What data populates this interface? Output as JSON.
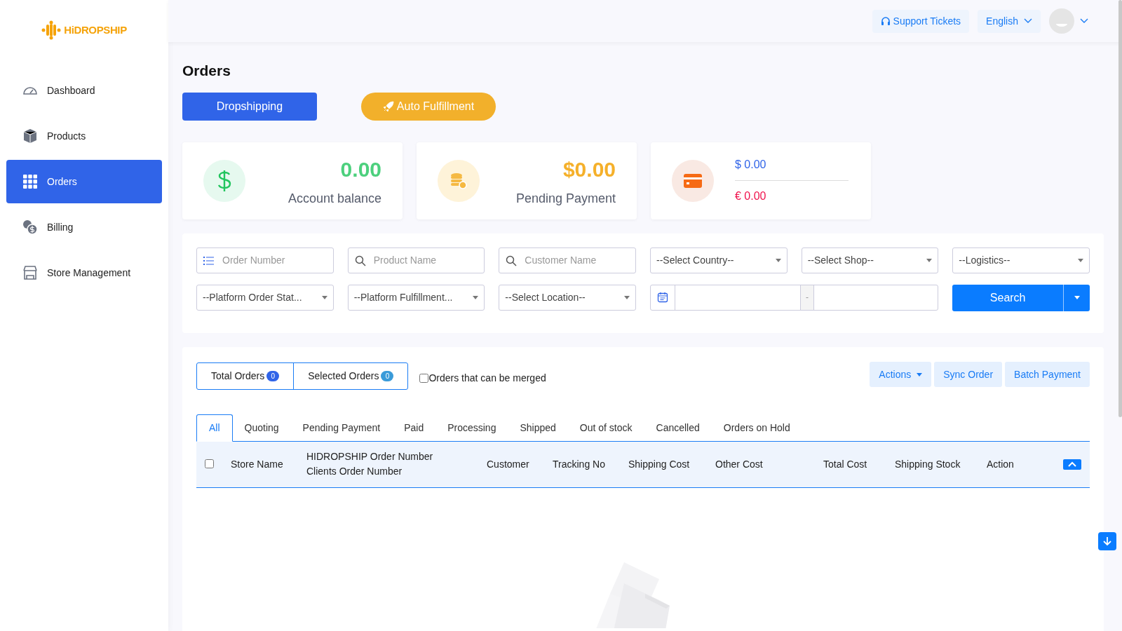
{
  "logo": {
    "text": "HiDROPSHIP"
  },
  "header": {
    "support": "Support Tickets",
    "language": "English"
  },
  "sidebar": {
    "items": [
      {
        "label": "Dashboard",
        "selected": false
      },
      {
        "label": "Products",
        "selected": false
      },
      {
        "label": "Orders",
        "selected": true
      },
      {
        "label": "Billing",
        "selected": false
      },
      {
        "label": "Store Management",
        "selected": false
      }
    ]
  },
  "page_title": "Orders",
  "mode_buttons": [
    {
      "label": "Dropshipping",
      "kind": "primary"
    },
    {
      "label": "Auto Fulfillment",
      "kind": "rocket"
    }
  ],
  "stats": [
    {
      "kind": "balance",
      "value": "0.00",
      "label": "Account balance"
    },
    {
      "kind": "pending",
      "value": "$0.00",
      "label": "Pending Payment"
    },
    {
      "kind": "currencies",
      "usd": "$ 0.00",
      "eur": "€ 0.00"
    }
  ],
  "filters": [
    {
      "kind": "field",
      "placeholder": "Order Number"
    },
    {
      "kind": "field",
      "placeholder": "Product Name"
    },
    {
      "kind": "field",
      "placeholder": "Customer Name"
    },
    {
      "kind": "select",
      "value": "--Select Country--"
    },
    {
      "kind": "select",
      "value": "--Select Shop--"
    },
    {
      "kind": "select",
      "value": "--Logistics--"
    },
    {
      "kind": "select",
      "value": "--Platform Order Stat..."
    },
    {
      "kind": "select",
      "value": "--Platform Fulfillment..."
    },
    {
      "kind": "select",
      "value": "--Select Location--"
    },
    {
      "kind": "date",
      "separator": "-"
    }
  ],
  "search_button": "Search",
  "counters": [
    {
      "label": "Total Orders",
      "count": "0",
      "kind": "total"
    },
    {
      "label": "Selected Orders",
      "count": "0",
      "kind": "selected"
    }
  ],
  "merge_checkbox": {
    "label": "Orders that can be merged",
    "checked": false
  },
  "actions": [
    "Actions",
    "Sync Order",
    "Batch Payment"
  ],
  "tabs": [
    {
      "label": "All",
      "selected": true
    },
    {
      "label": "Quoting",
      "selected": false
    },
    {
      "label": "Pending Payment",
      "selected": false
    },
    {
      "label": "Paid",
      "selected": false
    },
    {
      "label": "Processing",
      "selected": false
    },
    {
      "label": "Shipped",
      "selected": false
    },
    {
      "label": "Out of stock",
      "selected": false
    },
    {
      "label": "Cancelled",
      "selected": false
    },
    {
      "label": "Orders on Hold",
      "selected": false
    }
  ],
  "table": {
    "select_all_checked": false,
    "columns": [
      "Store Name",
      "HIDROPSHIP Order Number\nClients Order Number",
      "Customer",
      "Tracking No",
      "Shipping Cost",
      "Other Cost",
      "Total Cost",
      "Shipping Stock",
      "Action"
    ]
  }
}
